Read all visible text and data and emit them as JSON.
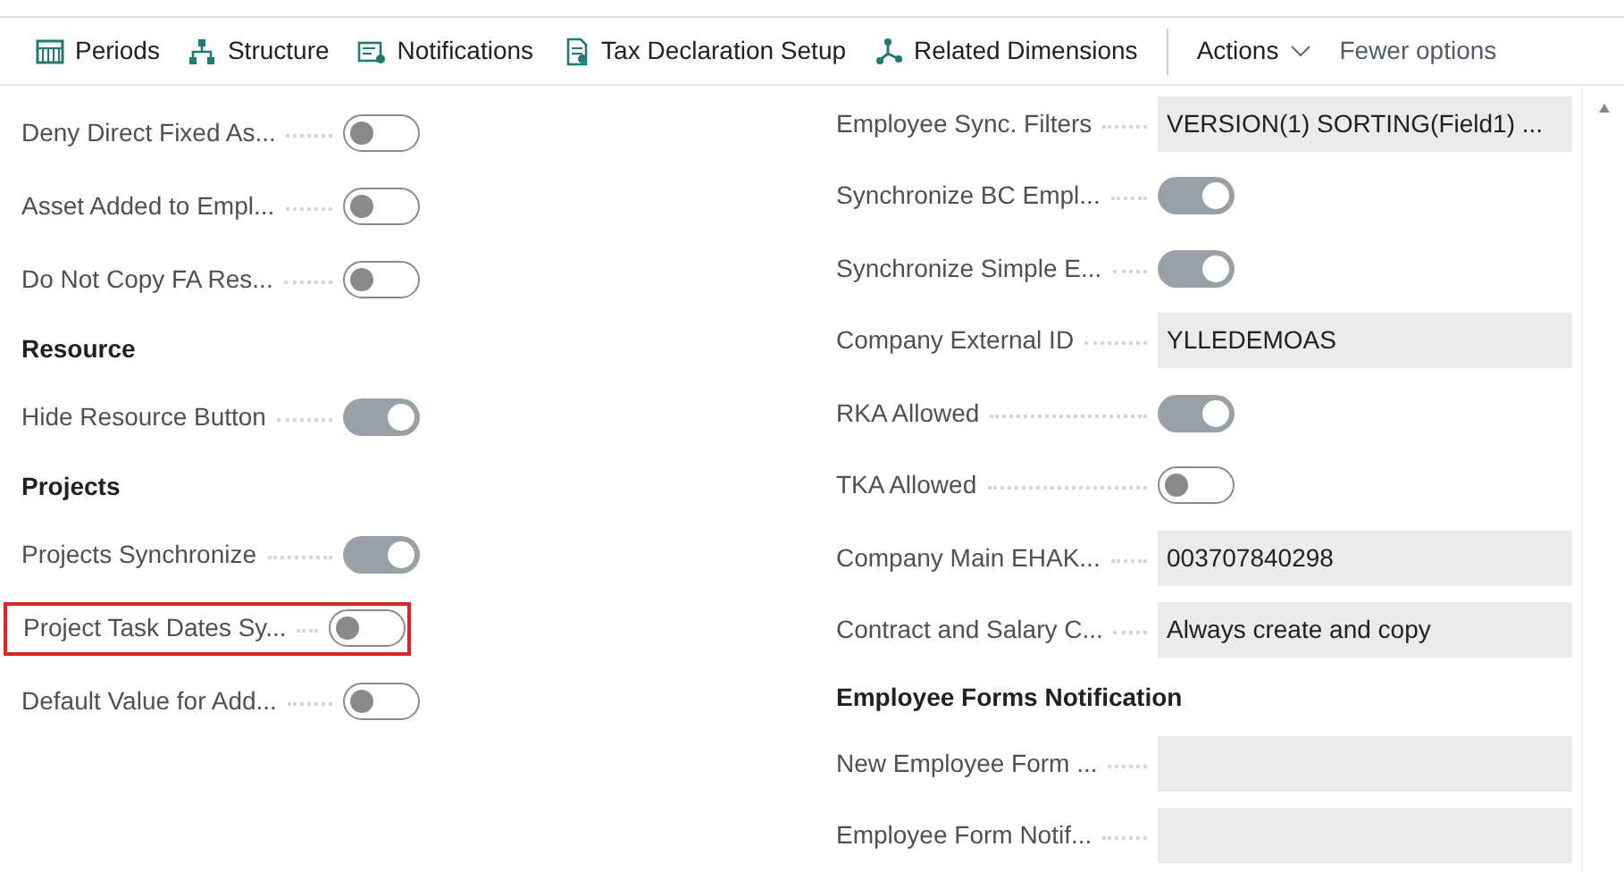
{
  "toolbar": {
    "actions": [
      {
        "label": "Periods"
      },
      {
        "label": "Structure"
      },
      {
        "label": "Notifications"
      },
      {
        "label": "Tax Declaration Setup"
      },
      {
        "label": "Related Dimensions"
      }
    ],
    "menu": {
      "label": "Actions"
    },
    "fewer": "Fewer options"
  },
  "left_fields": [
    {
      "kind": "toggle",
      "label": "Deny Direct Fixed As...",
      "on": false,
      "highlighted": false
    },
    {
      "kind": "toggle",
      "label": "Asset Added to Empl...",
      "on": false,
      "highlighted": false
    },
    {
      "kind": "toggle",
      "label": "Do Not Copy FA Res...",
      "on": false,
      "highlighted": false
    },
    {
      "kind": "heading",
      "label": "Resource"
    },
    {
      "kind": "toggle",
      "label": "Hide Resource Button",
      "on": true,
      "highlighted": false
    },
    {
      "kind": "heading",
      "label": "Projects"
    },
    {
      "kind": "toggle",
      "label": "Projects Synchronize",
      "on": true,
      "highlighted": false
    },
    {
      "kind": "toggle",
      "label": "Project Task Dates Sy...",
      "on": false,
      "highlighted": true
    },
    {
      "kind": "toggle",
      "label": "Default Value for Add...",
      "on": false,
      "highlighted": false
    }
  ],
  "right_fields": [
    {
      "kind": "text",
      "label": "Employee Sync. Filters",
      "value": "VERSION(1) SORTING(Field1) ..."
    },
    {
      "kind": "toggle",
      "label": "Synchronize BC Empl...",
      "on": true
    },
    {
      "kind": "toggle",
      "label": "Synchronize Simple E...",
      "on": true
    },
    {
      "kind": "text",
      "label": "Company External ID",
      "value": "YLLEDEMOAS"
    },
    {
      "kind": "toggle",
      "label": "RKA Allowed",
      "on": true
    },
    {
      "kind": "toggle",
      "label": "TKA Allowed",
      "on": false
    },
    {
      "kind": "text",
      "label": "Company Main EHAK...",
      "value": "003707840298"
    },
    {
      "kind": "text",
      "label": "Contract and Salary C...",
      "value": "Always create and copy"
    },
    {
      "kind": "heading",
      "label": "Employee Forms Notification"
    },
    {
      "kind": "text",
      "label": "New Employee Form ..."
    },
    {
      "kind": "text",
      "label": "Employee Form Notif..."
    }
  ]
}
